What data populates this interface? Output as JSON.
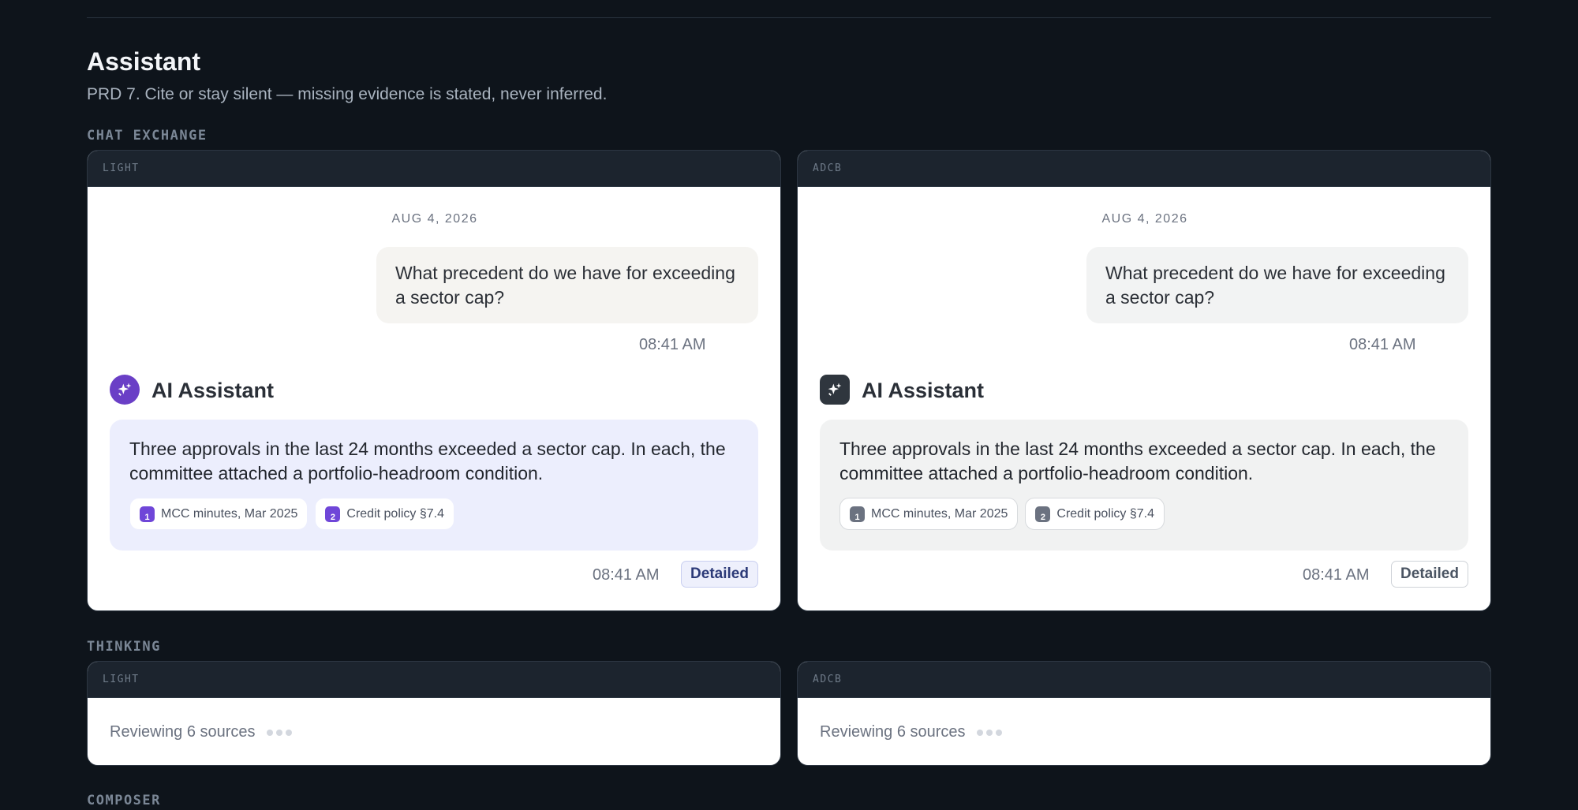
{
  "page": {
    "title": "Assistant",
    "subtitle": "PRD 7. Cite or stay silent — missing evidence is stated, never inferred."
  },
  "sections": {
    "chat_exchange": "CHAT EXCHANGE",
    "thinking": "THINKING",
    "composer": "COMPOSER"
  },
  "themes": {
    "light": "LIGHT",
    "adcb": "ADCB"
  },
  "chat": {
    "date": "AUG 4, 2026",
    "user_message": "What precedent do we have for exceeding a sector cap?",
    "user_time": "08:41 AM",
    "assistant_name": "AI Assistant",
    "assistant_message": "Three approvals in the last 24 months exceeded a sector cap. In each, the committee attached a portfolio-headroom condition.",
    "citations": [
      {
        "num": "1",
        "label": "MCC minutes, Mar 2025"
      },
      {
        "num": "2",
        "label": "Credit policy §7.4"
      }
    ],
    "assistant_time": "08:41 AM",
    "detail_label": "Detailed"
  },
  "thinking": {
    "status": "Reviewing 6 sources"
  },
  "icons": {
    "avatar": "sparkles-icon"
  },
  "colors": {
    "light_accent": "#6a3fc6",
    "adcb_accent": "#2f363e",
    "background": "#0e141b"
  }
}
